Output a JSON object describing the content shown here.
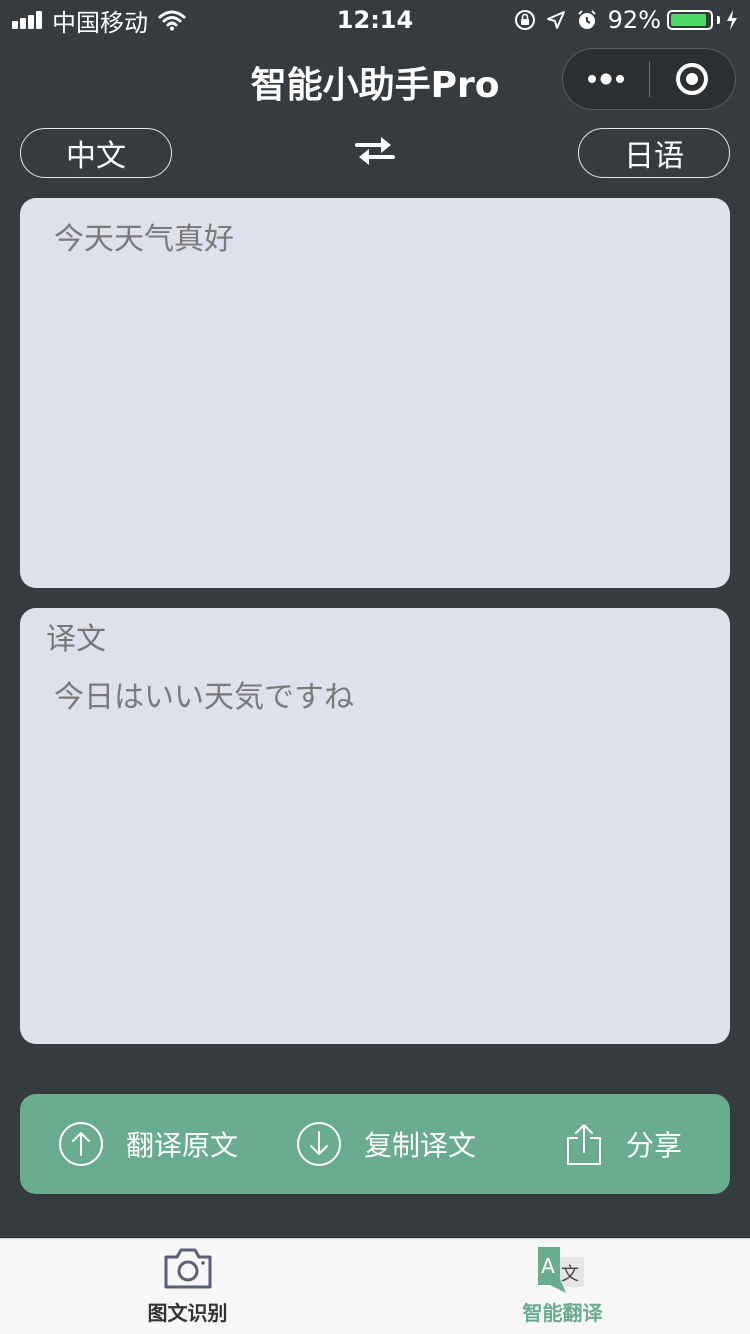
{
  "status_bar": {
    "carrier": "中国移动",
    "time": "12:14",
    "battery_percent": "92%",
    "battery_level": 0.92,
    "icons": [
      "signal-icon",
      "wifi-icon",
      "rotation-lock-icon",
      "location-icon",
      "alarm-icon",
      "battery-icon",
      "charging-icon"
    ]
  },
  "nav": {
    "title": "智能小助手Pro",
    "capsule_icons": [
      "more-dots-icon",
      "close-target-icon"
    ]
  },
  "languages": {
    "source": "中文",
    "target": "日语",
    "swap_icon": "swap-arrows-icon"
  },
  "input": {
    "text": "今天天气真好"
  },
  "output": {
    "label": "译文",
    "text": "今日はいい天気ですね"
  },
  "actions": [
    {
      "label": "翻译原文",
      "icon": "upload-circle-icon"
    },
    {
      "label": "复制译文",
      "icon": "download-circle-icon"
    },
    {
      "label": "分享",
      "icon": "share-icon"
    }
  ],
  "tabs": [
    {
      "label": "图文识别",
      "icon": "camera-icon",
      "active": false
    },
    {
      "label": "智能翻译",
      "icon": "translate-icon",
      "active": true
    }
  ],
  "colors": {
    "background": "#363b3f",
    "panel": "#dee1ec",
    "accent": "#6aad8e",
    "tabbar": "#f7f7f7"
  }
}
